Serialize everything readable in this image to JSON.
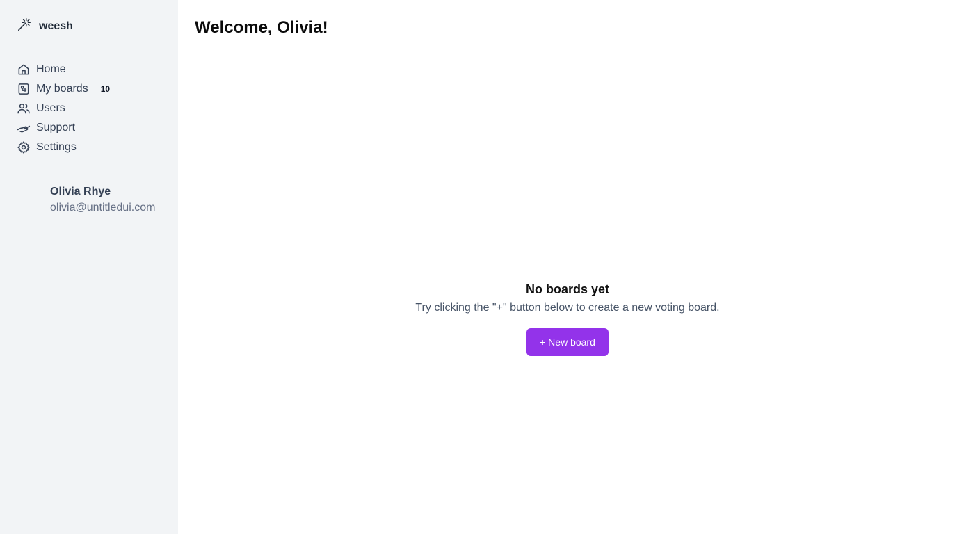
{
  "brand": {
    "name": "weesh",
    "icon": "magic-wand-icon"
  },
  "nav": {
    "items": [
      {
        "label": "Home",
        "icon": "home-icon"
      },
      {
        "label": "My boards",
        "icon": "boards-icon",
        "badge": "10"
      },
      {
        "label": "Users",
        "icon": "users-icon"
      },
      {
        "label": "Support",
        "icon": "support-handshake-icon"
      },
      {
        "label": "Settings",
        "icon": "gear-icon"
      }
    ]
  },
  "user": {
    "name": "Olivia Rhye",
    "email": "olivia@untitledui.com"
  },
  "main": {
    "title": "Welcome, Olivia!",
    "empty_state": {
      "title": "No boards yet",
      "subtitle": "Try clicking the \"+\" button below to create a new voting board.",
      "button_label": "+ New board"
    }
  },
  "colors": {
    "sidebar_bg": "#f2f4f6",
    "accent": "#9333ea",
    "text_muted": "#667085"
  }
}
